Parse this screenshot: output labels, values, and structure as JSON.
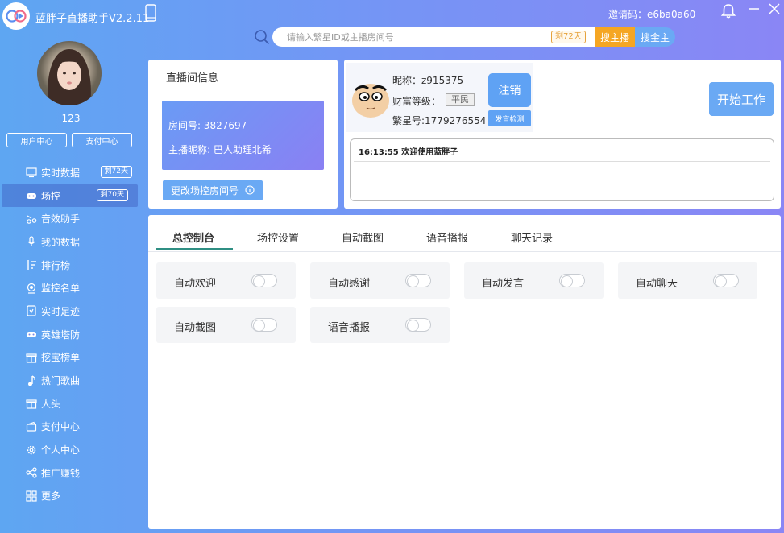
{
  "app": {
    "title": "蓝胖子直播助手V2.2.11",
    "invite_code": "邀请码：e6ba0a60"
  },
  "search": {
    "placeholder": "请输入繁星ID或主播房间号",
    "days_badge": "剩72天",
    "search_host_label": "搜主播",
    "search_gold_label": "搜金主"
  },
  "sidebar": {
    "username": "123",
    "user_center_label": "用户中心",
    "pay_center_label": "支付中心",
    "items": [
      {
        "label": "实时数据",
        "icon": "monitor-icon",
        "badge": "剩72天"
      },
      {
        "label": "场控",
        "icon": "gamepad-icon",
        "badge": "剩70天",
        "active": true
      },
      {
        "label": "音效助手",
        "icon": "music-note-icon",
        "badge": ""
      },
      {
        "label": "我的数据",
        "icon": "microphone-icon",
        "badge": ""
      },
      {
        "label": "排行榜",
        "icon": "sort-icon",
        "badge": ""
      },
      {
        "label": "监控名单",
        "icon": "target-icon",
        "badge": ""
      },
      {
        "label": "实时足迹",
        "icon": "footprint-icon",
        "badge": ""
      },
      {
        "label": "英雄塔防",
        "icon": "gamepad-icon",
        "badge": ""
      },
      {
        "label": "挖宝榜单",
        "icon": "gift-icon",
        "badge": ""
      },
      {
        "label": "热门歌曲",
        "icon": "music-icon",
        "badge": ""
      },
      {
        "label": "人头",
        "icon": "gift-icon",
        "badge": ""
      },
      {
        "label": "支付中心",
        "icon": "wallet-icon",
        "badge": ""
      },
      {
        "label": "个人中心",
        "icon": "gear-icon",
        "badge": ""
      },
      {
        "label": "推广赚钱",
        "icon": "share-icon",
        "badge": ""
      },
      {
        "label": "更多",
        "icon": "grid-icon",
        "badge": ""
      }
    ]
  },
  "room": {
    "title": "直播间信息",
    "room_no": "房间号: 3827697",
    "host_nick": "主播昵称: 巴人助理北希",
    "change_button": "更改场控房间号"
  },
  "account": {
    "nickname": "昵称：z915375",
    "wealth_label": "财富等级：",
    "wealth_rank": "平民",
    "star_no": "繁星号:1779276554",
    "logout_label": "注销",
    "speak_check_label": "发言检测",
    "start_work_label": "开始工作",
    "log": "16:13:55 欢迎使用蓝胖子"
  },
  "main": {
    "tabs": [
      {
        "label": "总控制台",
        "active": true
      },
      {
        "label": "场控设置"
      },
      {
        "label": "自动截图"
      },
      {
        "label": "语音播报"
      },
      {
        "label": "聊天记录"
      }
    ],
    "toggles": [
      {
        "label": "自动欢迎",
        "on": false
      },
      {
        "label": "自动感谢",
        "on": false
      },
      {
        "label": "自动发言",
        "on": false
      },
      {
        "label": "自动聊天",
        "on": false
      },
      {
        "label": "自动截图",
        "on": false
      },
      {
        "label": "语音播报",
        "on": false
      }
    ]
  },
  "colors": {
    "accent_blue": "#6aa9f4",
    "accent_orange": "#f5a623",
    "tab_underline": "#2f8f83"
  }
}
